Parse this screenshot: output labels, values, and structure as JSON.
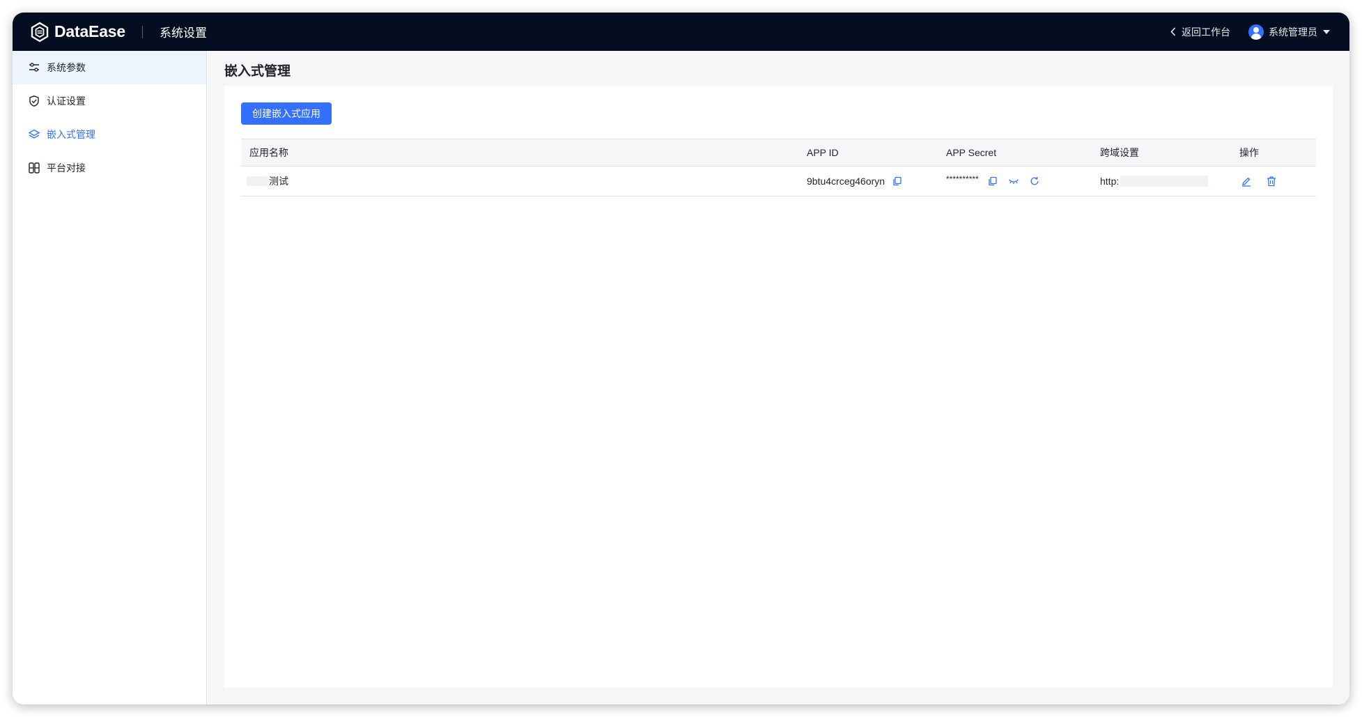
{
  "app": {
    "brand": "DataEase",
    "section_title": "系统设置"
  },
  "topbar": {
    "back_label": "返回工作台",
    "user_name": "系统管理员"
  },
  "sidebar": {
    "items": [
      {
        "label": "系统参数",
        "icon": "sliders-icon"
      },
      {
        "label": "认证设置",
        "icon": "shield-check-icon"
      },
      {
        "label": "嵌入式管理",
        "icon": "layers-icon",
        "active": true
      },
      {
        "label": "平台对接",
        "icon": "platform-icon"
      }
    ]
  },
  "main": {
    "title": "嵌入式管理",
    "create_button": "创建嵌入式应用",
    "table": {
      "headers": [
        "应用名称",
        "APP ID",
        "APP Secret",
        "跨域设置",
        "操作"
      ],
      "rows": [
        {
          "name": "测试",
          "app_id": "9btu4crceg46oryn",
          "app_secret": "**********",
          "cors": "http:"
        }
      ]
    }
  },
  "colors": {
    "topbar": "#050e21",
    "accent": "#3370ff",
    "active_bg": "#eef4fe"
  }
}
